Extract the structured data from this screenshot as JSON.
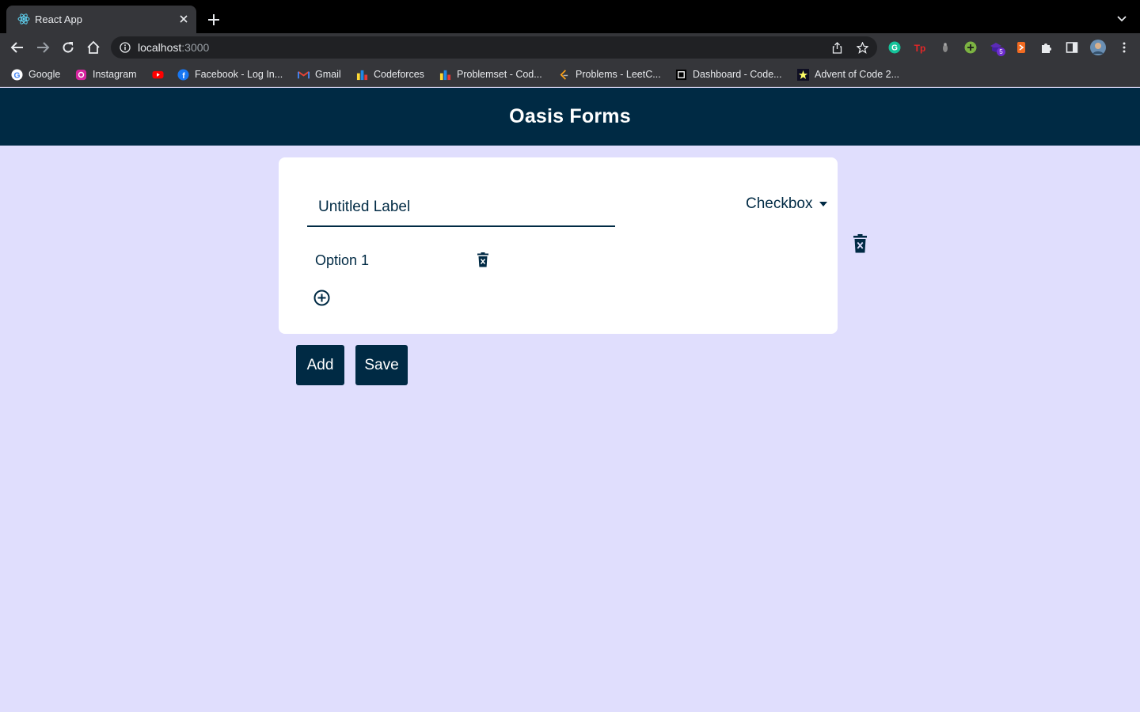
{
  "browser": {
    "tab_title": "React App",
    "url_host": "localhost",
    "url_port": ":3000",
    "bookmarks": [
      {
        "label": "Google",
        "icon": "google-icon"
      },
      {
        "label": "Instagram",
        "icon": "instagram-icon"
      },
      {
        "label": "",
        "icon": "youtube-icon"
      },
      {
        "label": "Facebook - Log In...",
        "icon": "facebook-icon"
      },
      {
        "label": "Gmail",
        "icon": "gmail-icon"
      },
      {
        "label": "Codeforces",
        "icon": "codeforces-icon"
      },
      {
        "label": "Problemset - Cod...",
        "icon": "codeforces-icon"
      },
      {
        "label": "Problems - LeetC...",
        "icon": "leetcode-icon"
      },
      {
        "label": "Dashboard - Code...",
        "icon": "codechef-icon"
      },
      {
        "label": "Advent of Code 2...",
        "icon": "advent-icon"
      }
    ],
    "extension_badge": "5"
  },
  "app": {
    "title": "Oasis Forms",
    "accent_color": "#002a44",
    "background_color": "#e0defd"
  },
  "question": {
    "label_value": "Untitled Label",
    "type": "Checkbox",
    "options": [
      "Option 1"
    ]
  },
  "actions": {
    "add_label": "Add",
    "save_label": "Save"
  }
}
